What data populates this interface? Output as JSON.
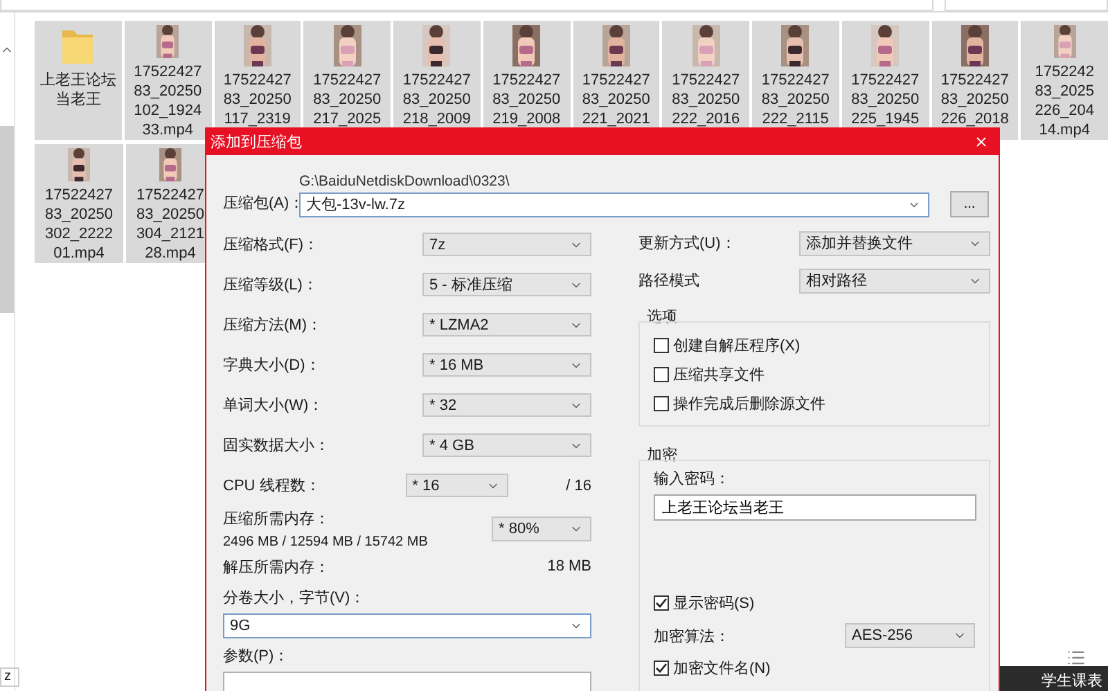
{
  "explorer": {
    "files": [
      {
        "kind": "folder",
        "selected": true,
        "label_lines": [
          "上老王论坛",
          "当老王"
        ]
      },
      {
        "kind": "video",
        "selected": true,
        "label_lines": [
          "17522427",
          "83_20250",
          "102_1924",
          "33.mp4"
        ]
      },
      {
        "kind": "video",
        "selected": true,
        "label_lines": [
          "17522427",
          "83_20250",
          "117_2319"
        ]
      },
      {
        "kind": "video",
        "selected": true,
        "label_lines": [
          "17522427",
          "83_20250",
          "217_2025"
        ]
      },
      {
        "kind": "video",
        "selected": true,
        "label_lines": [
          "17522427",
          "83_20250",
          "218_2009"
        ]
      },
      {
        "kind": "video",
        "selected": true,
        "label_lines": [
          "17522427",
          "83_20250",
          "219_2008"
        ]
      },
      {
        "kind": "video",
        "selected": true,
        "label_lines": [
          "17522427",
          "83_20250",
          "221_2021"
        ]
      },
      {
        "kind": "video",
        "selected": true,
        "label_lines": [
          "17522427",
          "83_20250",
          "222_2016"
        ]
      },
      {
        "kind": "video",
        "selected": true,
        "label_lines": [
          "17522427",
          "83_20250",
          "222_2115"
        ]
      },
      {
        "kind": "video",
        "selected": true,
        "label_lines": [
          "17522427",
          "83_20250",
          "225_1945"
        ]
      },
      {
        "kind": "video",
        "selected": true,
        "label_lines": [
          "17522427",
          "83_20250",
          "226_2018"
        ]
      },
      {
        "kind": "video",
        "selected": true,
        "label_lines": [
          "1752242",
          "83_2025",
          "226_204",
          "14.mp4"
        ]
      },
      {
        "kind": "video",
        "selected": true,
        "label_lines": [
          "17522427",
          "83_20250",
          "302_2222",
          "01.mp4"
        ]
      },
      {
        "kind": "video",
        "selected": true,
        "label_lines": [
          "17522427",
          "83_20250",
          "304_2121",
          "28.mp4"
        ]
      }
    ],
    "drive_field": "z",
    "taskbar_text": "学生课表"
  },
  "dialog": {
    "title": "添加到压缩包",
    "archive": {
      "label": "压缩包(A)：",
      "path": "G:\\BaiduNetdiskDownload\\0323\\",
      "value": "大包-13v-lw.7z",
      "browse_button": "..."
    },
    "settings": [
      {
        "label": "压缩格式(F)：",
        "value": "7z"
      },
      {
        "label": "压缩等级(L)：",
        "value": "5 - 标准压缩"
      },
      {
        "label": "压缩方法(M)：",
        "value": "* LZMA2"
      },
      {
        "label": "字典大小(D)：",
        "value": "* 16 MB"
      },
      {
        "label": "单词大小(W)：",
        "value": "* 32"
      },
      {
        "label": "固实数据大小：",
        "value": "* 4 GB"
      },
      {
        "label": "CPU 线程数：",
        "value": "* 16",
        "suffix": "/ 16"
      }
    ],
    "memory": {
      "label": "压缩所需内存：",
      "detail": "2496 MB / 12594 MB / 15742 MB",
      "value": "* 80%"
    },
    "decompress_memory": {
      "label": "解压所需内存：",
      "value": "18 MB"
    },
    "split": {
      "label": "分卷大小，字节(V)：",
      "value": "9G"
    },
    "parameters": {
      "label": "参数(P)："
    },
    "update_mode": {
      "label": "更新方式(U)：",
      "value": "添加并替换文件"
    },
    "path_mode": {
      "label": "路径模式",
      "value": "相对路径"
    },
    "options": {
      "title": "选项",
      "items": [
        {
          "label": "创建自解压程序(X)",
          "checked": false
        },
        {
          "label": "压缩共享文件",
          "checked": false
        },
        {
          "label": "操作完成后删除源文件",
          "checked": false
        }
      ]
    },
    "encryption": {
      "title": "加密",
      "password_label": "输入密码：",
      "password": "上老王论坛当老王",
      "show_password": {
        "label": "显示密码(S)",
        "checked": true
      },
      "method": {
        "label": "加密算法：",
        "value": "AES-256"
      },
      "encrypt_names": {
        "label": "加密文件名(N)",
        "checked": true
      }
    }
  }
}
